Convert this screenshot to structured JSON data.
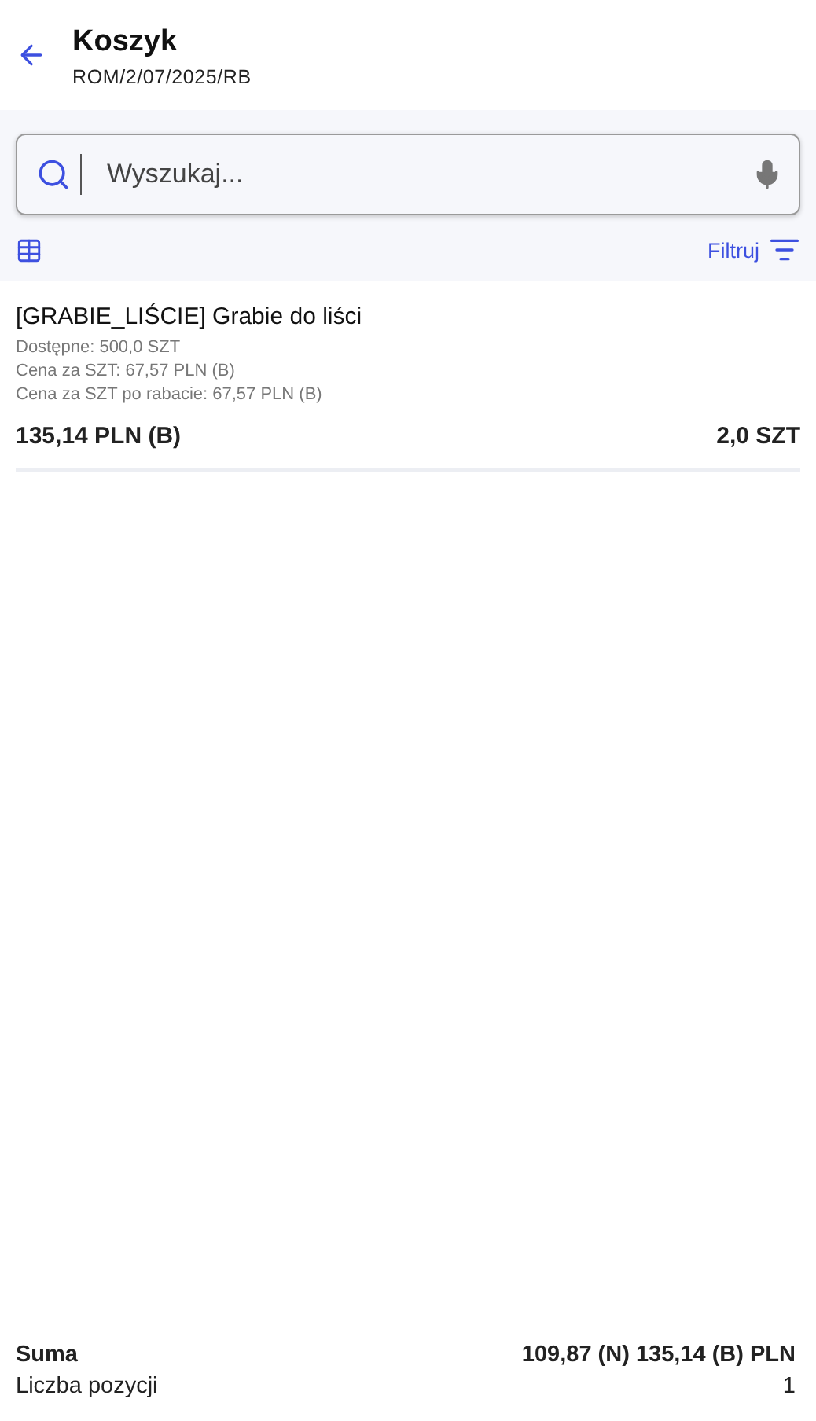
{
  "header": {
    "title": "Koszyk",
    "subtitle": "ROM/2/07/2025/RB"
  },
  "search": {
    "placeholder": "Wyszukaj..."
  },
  "toolbar": {
    "filter_label": "Filtruj"
  },
  "items": [
    {
      "name": "[GRABIE_LIŚCIE] Grabie do liści",
      "details": [
        "Dostępne: 500,0 SZT",
        "Cena za SZT: 67,57 PLN (B)",
        "Cena za SZT po rabacie: 67,57 PLN (B)"
      ],
      "total": "135,14 PLN (B)",
      "quantity": "2,0 SZT"
    }
  ],
  "summary": [
    {
      "label": "Suma",
      "value": "109,87 (N) 135,14 (B) PLN",
      "kind": "strong"
    },
    {
      "label": "Liczba pozycji",
      "value": "1",
      "kind": "plain"
    }
  ]
}
